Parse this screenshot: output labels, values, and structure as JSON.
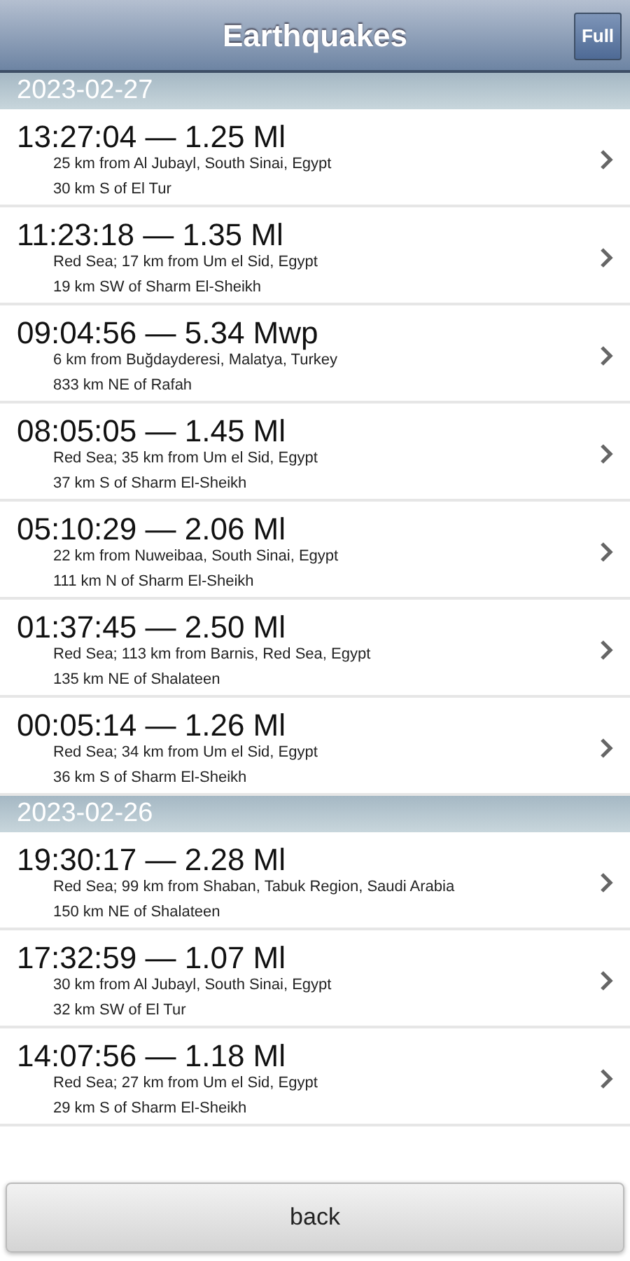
{
  "header": {
    "title": "Earthquakes",
    "full_button": "Full"
  },
  "sections": [
    {
      "date": "2023-02-27",
      "quakes": [
        {
          "title": "13:27:04 — 1.25 Ml",
          "location": "25 km from Al Jubayl, South Sinai, Egypt",
          "relative": "30 km S of El Tur"
        },
        {
          "title": "11:23:18 — 1.35 Ml",
          "location": "Red Sea; 17 km from Um el Sid, Egypt",
          "relative": "19 km SW of Sharm El-Sheikh"
        },
        {
          "title": "09:04:56 — 5.34 Mwp",
          "location": "6 km from Buğdayderesi, Malatya, Turkey",
          "relative": "833 km NE of Rafah"
        },
        {
          "title": "08:05:05 — 1.45 Ml",
          "location": "Red Sea; 35 km from Um el Sid, Egypt",
          "relative": "37 km S of Sharm El-Sheikh"
        },
        {
          "title": "05:10:29 — 2.06 Ml",
          "location": "22 km from Nuweibaa, South Sinai, Egypt",
          "relative": "111 km N of Sharm El-Sheikh"
        },
        {
          "title": "01:37:45 — 2.50 Ml",
          "location": "Red Sea; 113 km from Barnis, Red Sea, Egypt",
          "relative": "135 km NE of Shalateen"
        },
        {
          "title": "00:05:14 — 1.26 Ml",
          "location": "Red Sea; 34 km from Um el Sid, Egypt",
          "relative": "36 km S of Sharm El-Sheikh"
        }
      ]
    },
    {
      "date": "2023-02-26",
      "quakes": [
        {
          "title": "19:30:17 — 2.28 Ml",
          "location": "Red Sea; 99 km from Shaban, Tabuk Region, Saudi Arabia",
          "relative": "150 km NE of Shalateen"
        },
        {
          "title": "17:32:59 — 1.07 Ml",
          "location": "30 km from Al Jubayl, South Sinai, Egypt",
          "relative": "32 km SW of El Tur"
        },
        {
          "title": "14:07:56 — 1.18 Ml",
          "location": "Red Sea; 27 km from Um el Sid, Egypt",
          "relative": "29 km S of Sharm El-Sheikh"
        }
      ]
    }
  ],
  "footer": {
    "back_button": "back"
  }
}
